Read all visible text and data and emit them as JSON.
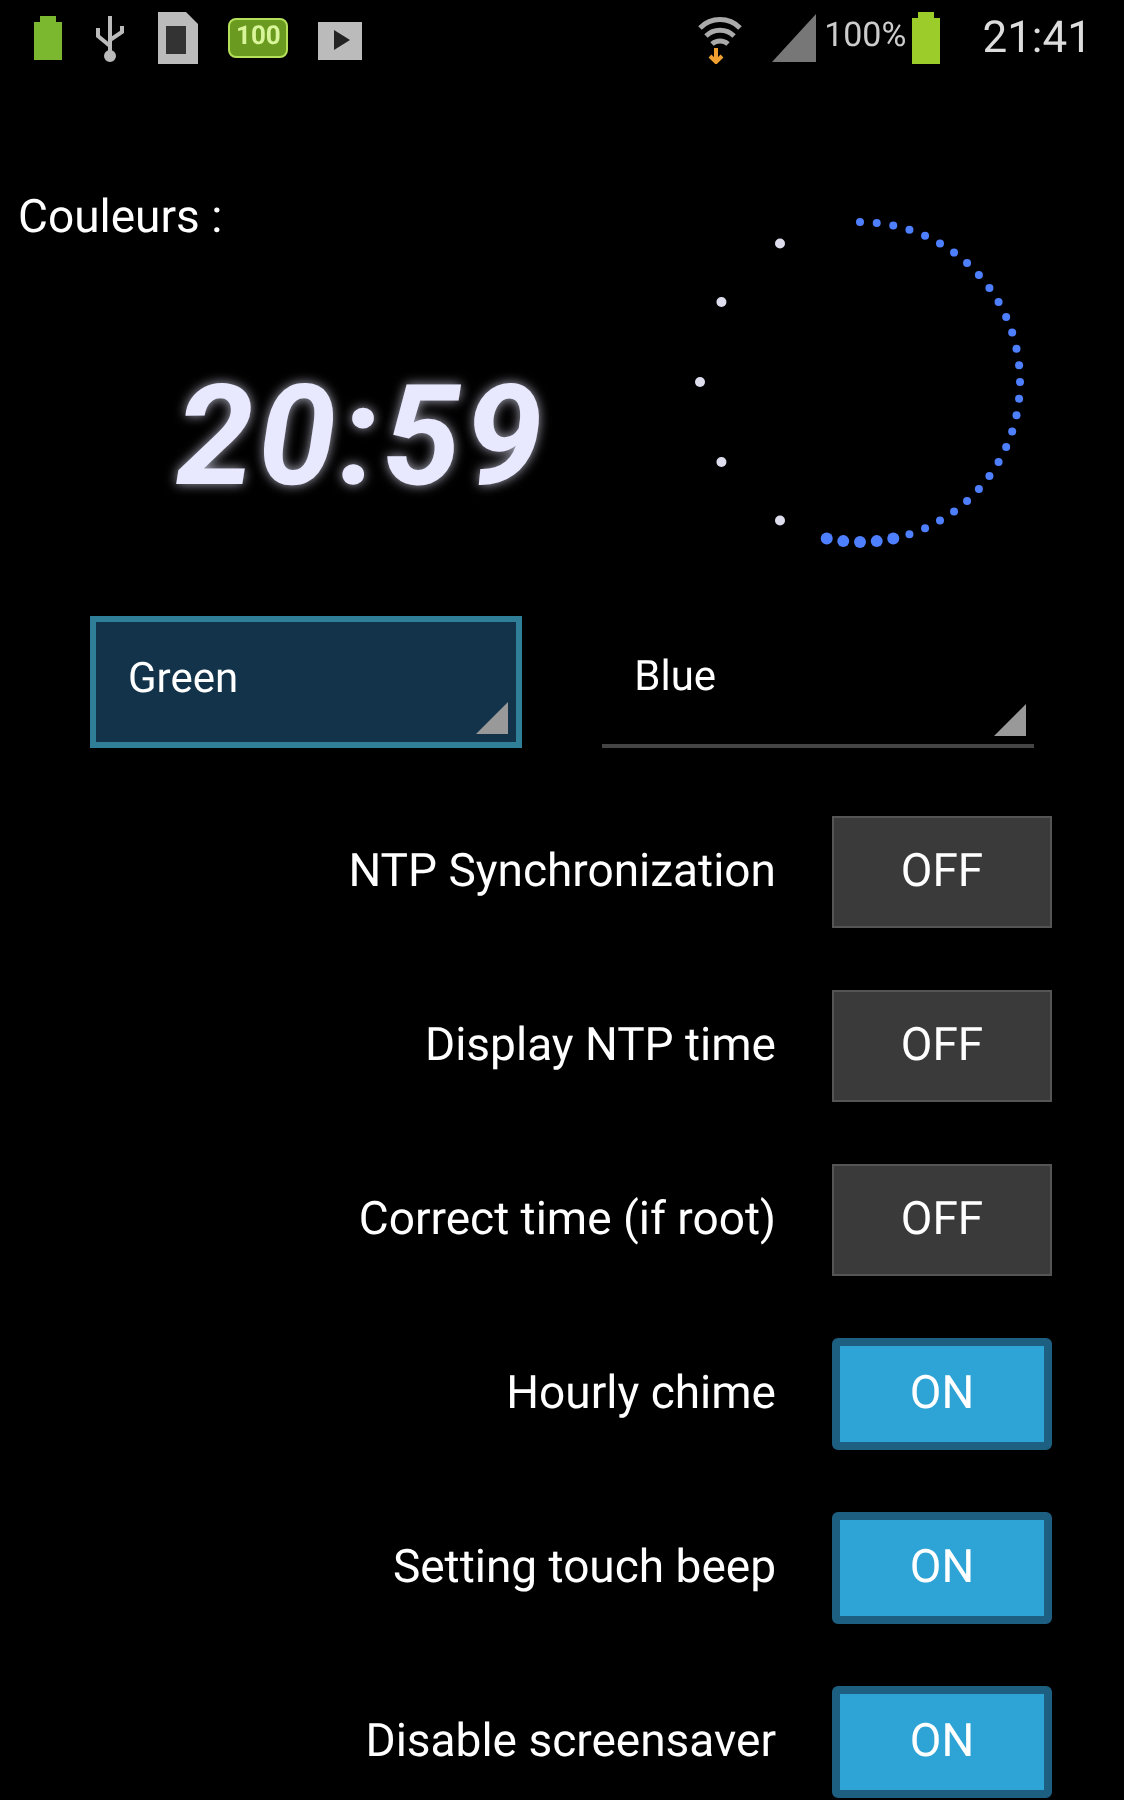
{
  "status_bar": {
    "notification_badge": "100",
    "battery_percent": "100%",
    "time": "21:41"
  },
  "colors": {
    "title": "Couleurs :",
    "digital_clock": "20:59"
  },
  "spinners": [
    {
      "value": "Green",
      "selected": true
    },
    {
      "value": "Blue",
      "selected": false
    }
  ],
  "settings": [
    {
      "label": "NTP Synchronization",
      "on": false,
      "toggle_text": "OFF"
    },
    {
      "label": "Display NTP time",
      "on": false,
      "toggle_text": "OFF"
    },
    {
      "label": "Correct time (if root)",
      "on": false,
      "toggle_text": "OFF"
    },
    {
      "label": "Hourly chime",
      "on": true,
      "toggle_text": "ON"
    },
    {
      "label": "Setting touch beep",
      "on": true,
      "toggle_text": "ON"
    },
    {
      "label": "Disable screensaver",
      "on": true,
      "toggle_text": "ON"
    }
  ]
}
